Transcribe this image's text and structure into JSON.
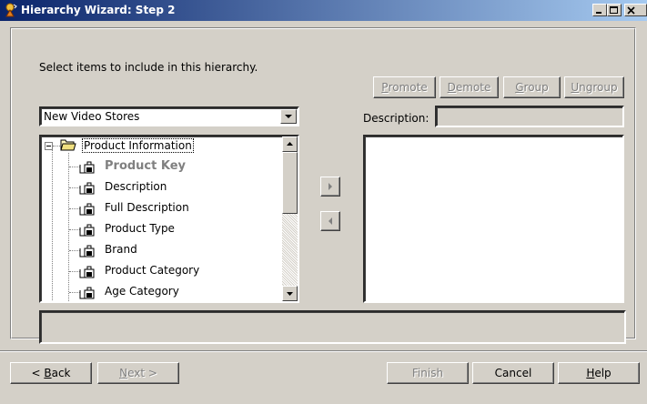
{
  "window": {
    "title": "Hierarchy Wizard: Step 2",
    "title_icon": "wizard-icon",
    "controls": [
      "minimize-icon",
      "maximize-icon",
      "close-icon"
    ]
  },
  "instruction": "Select items to include in this hierarchy.",
  "action_buttons": {
    "promote": {
      "label_u": "P",
      "label_rest": "romote",
      "enabled": false
    },
    "demote": {
      "label_u": "D",
      "label_rest": "emote",
      "enabled": false
    },
    "group": {
      "label_u": "G",
      "label_rest": "roup",
      "enabled": false
    },
    "ungroup": {
      "label_u": "U",
      "label_rest": "ngroup",
      "enabled": false
    }
  },
  "source_select": {
    "value": "New Video Stores"
  },
  "description": {
    "label": "Description:",
    "value": ""
  },
  "tree": {
    "root": "Product Information",
    "items": [
      {
        "label": "Product Key",
        "style": "key"
      },
      {
        "label": "Description"
      },
      {
        "label": "Full Description"
      },
      {
        "label": "Product Type"
      },
      {
        "label": "Brand"
      },
      {
        "label": "Product Category"
      },
      {
        "label": "Age Category"
      }
    ]
  },
  "move_buttons": {
    "add": "right-arrow-icon",
    "remove": "left-arrow-icon"
  },
  "status_text": "",
  "footer": {
    "back": {
      "label_pre": "< ",
      "label_u": "B",
      "label_rest": "ack",
      "enabled": true
    },
    "next": {
      "label_u": "N",
      "label_rest": "ext >",
      "enabled": false
    },
    "finish": {
      "label": "Finish",
      "enabled": false
    },
    "cancel": {
      "label": "Cancel",
      "enabled": true
    },
    "help": {
      "label_u": "H",
      "label_rest": "elp",
      "enabled": true
    }
  }
}
